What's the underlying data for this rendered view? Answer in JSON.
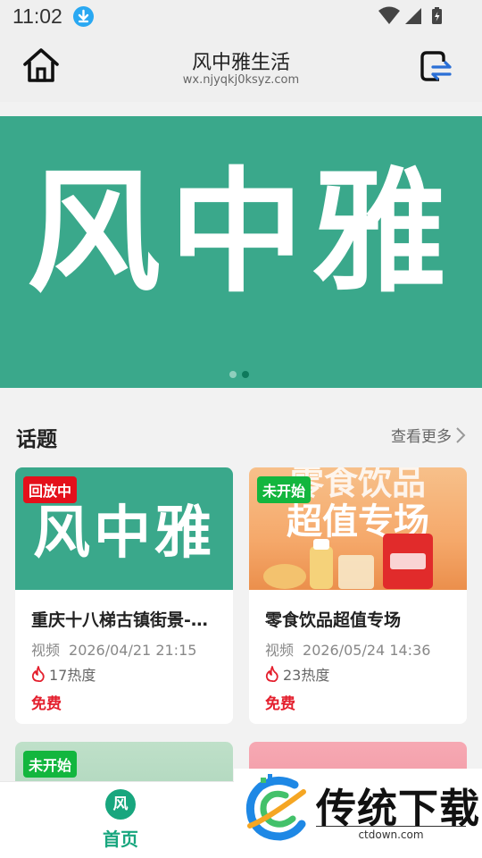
{
  "status_bar": {
    "time": "11:02"
  },
  "header": {
    "title": "风中雅生活",
    "domain": "wx.njyqkj0ksyz.com"
  },
  "banner": {
    "text": "风中雅",
    "slides": 2,
    "active_slide": 2,
    "color": "#3aa88b"
  },
  "topics": {
    "title": "话题",
    "more_label": "查看更多",
    "cards": [
      {
        "tag": "回放中",
        "tag_color": "#e4101b",
        "image_text": "风中雅",
        "title": "重庆十八梯古镇街景-…",
        "type": "视频",
        "datetime": "2026/04/21 21:15",
        "heat": "17热度",
        "price": "免费"
      },
      {
        "tag": "未开始",
        "tag_color": "#13b63e",
        "image_text_top": "零食饮品",
        "image_text": "超值专场",
        "title": "零食饮品超值专场",
        "type": "视频",
        "datetime": "2026/05/24 14:36",
        "heat": "23热度",
        "price": "免费"
      },
      {
        "tag": "未开始",
        "tag_color": "#13b63e"
      },
      {}
    ]
  },
  "bottom_nav": {
    "home_icon_text": "风",
    "home_label": "首页",
    "accent": "#18a67e"
  },
  "watermark": {
    "text": "传统下载",
    "sub": "ctdown.com"
  }
}
